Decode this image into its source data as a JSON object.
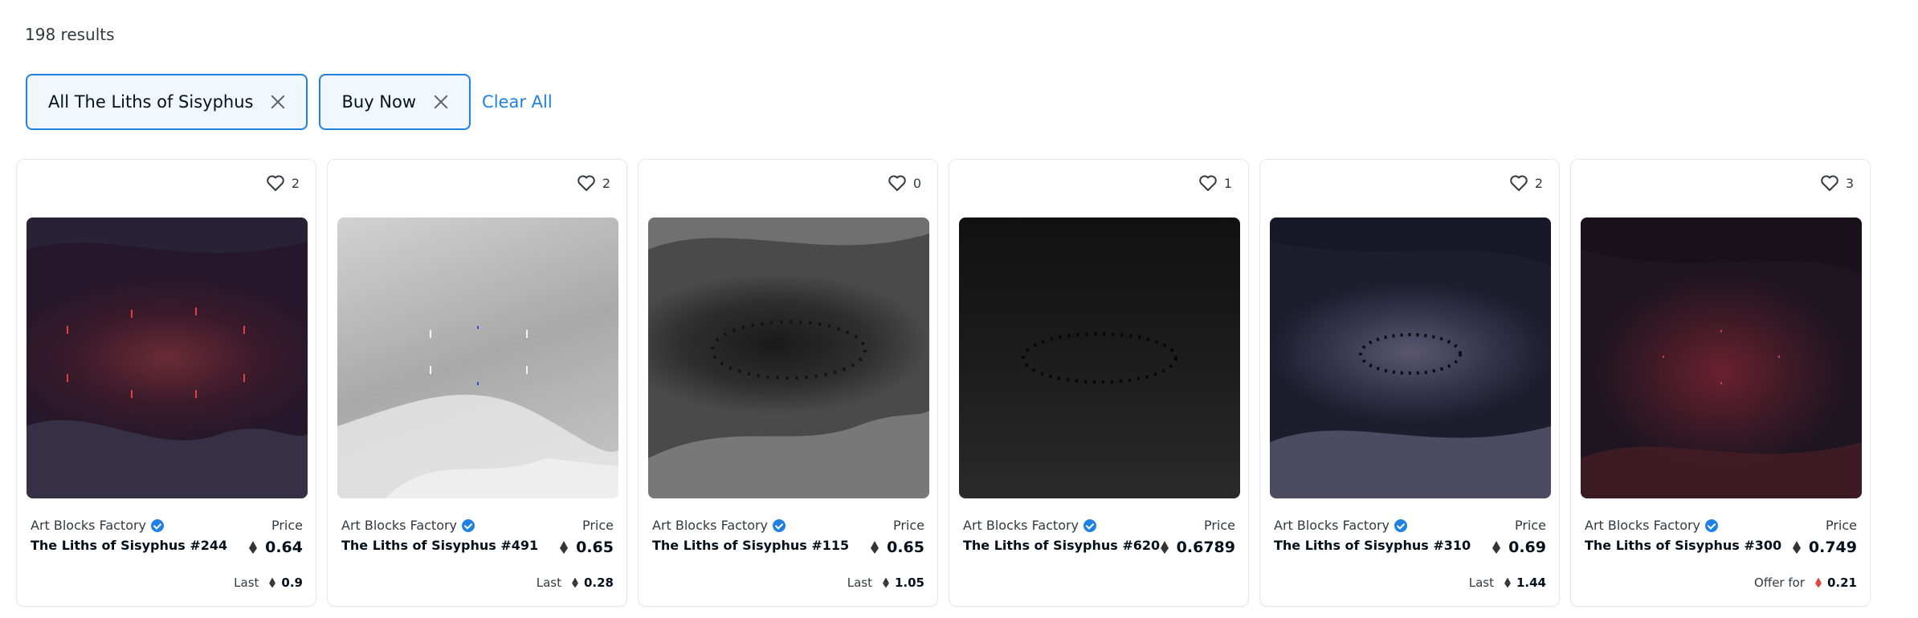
{
  "results": "198 results",
  "filters": {
    "chip1": "All The Liths of Sisyphus",
    "chip2": "Buy Now",
    "clear": "Clear All"
  },
  "price_label": "Price",
  "cards": [
    {
      "likes": "2",
      "creator": "Art Blocks Factory",
      "name": "The Liths of Sisyphus #244",
      "price": "0.64",
      "footer_label": "Last",
      "footer_value": "0.9",
      "bg": "#3a1e2a"
    },
    {
      "likes": "2",
      "creator": "Art Blocks Factory",
      "name": "The Liths of Sisyphus #491",
      "price": "0.65",
      "footer_label": "Last",
      "footer_value": "0.28",
      "bg": "#b9b9b9"
    },
    {
      "likes": "0",
      "creator": "Art Blocks Factory",
      "name": "The Liths of Sisyphus #115",
      "price": "0.65",
      "footer_label": "Last",
      "footer_value": "1.05",
      "bg": "#3a3a3a"
    },
    {
      "likes": "1",
      "creator": "Art Blocks Factory",
      "name": "The Liths of Sisyphus #620",
      "price": "0.6789",
      "footer_label": "",
      "footer_value": "",
      "bg": "#141414"
    },
    {
      "likes": "2",
      "creator": "Art Blocks Factory",
      "name": "The Liths of Sisyphus #310",
      "price": "0.69",
      "footer_label": "Last",
      "footer_value": "1.44",
      "bg": "#2f2f45"
    },
    {
      "likes": "3",
      "creator": "Art Blocks Factory",
      "name": "The Liths of Sisyphus #300",
      "price": "0.749",
      "footer_label": "Offer for",
      "footer_value": "0.21",
      "bg": "#3a1a22"
    }
  ]
}
